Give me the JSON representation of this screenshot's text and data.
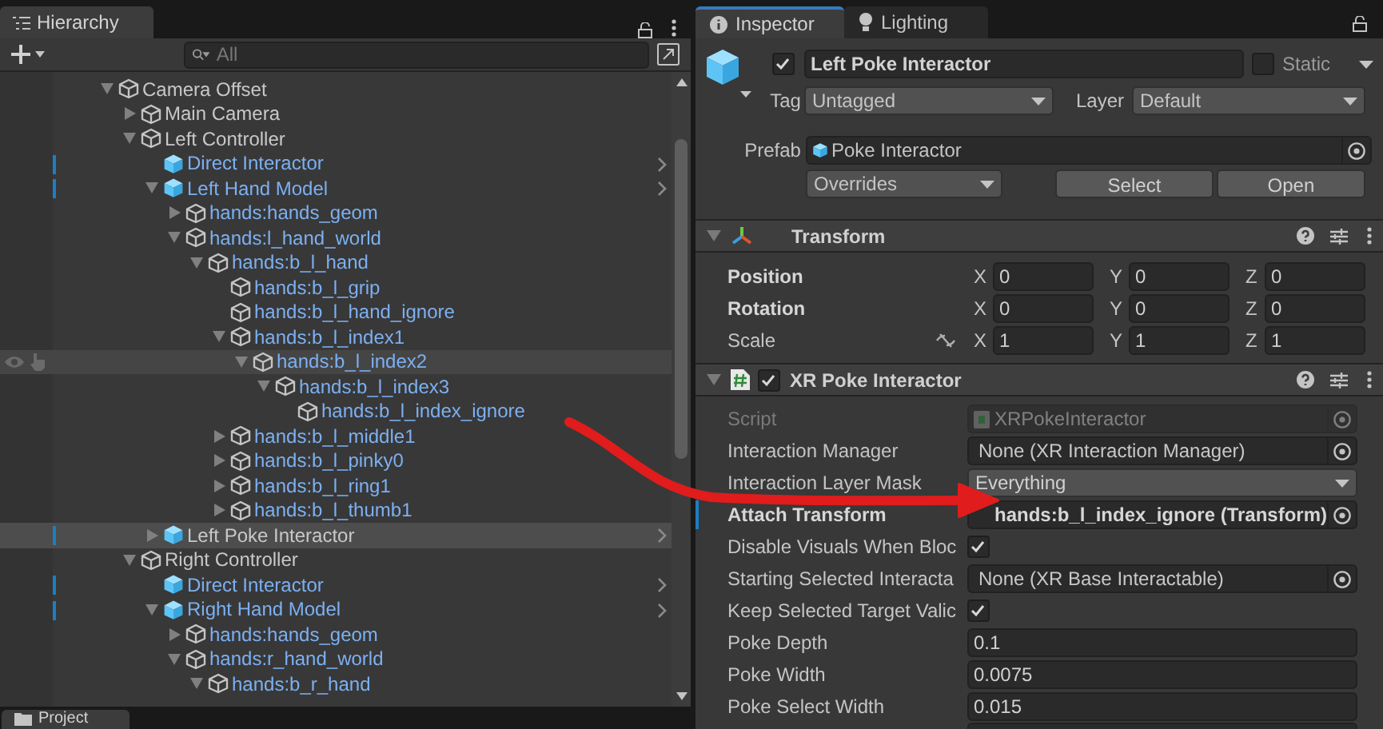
{
  "hierarchy": {
    "tab": {
      "label": "Hierarchy",
      "selected": true
    },
    "search": {
      "placeholder": "All"
    },
    "tree": [
      {
        "name": "Camera Offset",
        "kind": "object",
        "in_prefab": false,
        "selected": false,
        "hovered": false,
        "expanded": true,
        "children": [
          {
            "name": "Main Camera",
            "kind": "object",
            "in_prefab": false,
            "selected": false,
            "hovered": false,
            "expanded": false
          },
          {
            "name": "Left Controller",
            "kind": "object",
            "in_prefab": false,
            "selected": false,
            "hovered": false,
            "expanded": true,
            "children": [
              {
                "name": "Direct Interactor",
                "kind": "prefab",
                "in_prefab": true,
                "selected": false,
                "hovered": false
              },
              {
                "name": "Left Hand Model",
                "kind": "prefab",
                "in_prefab": true,
                "selected": false,
                "hovered": false,
                "expanded": true,
                "children": [
                  {
                    "name": "hands:hands_geom",
                    "kind": "object",
                    "in_prefab": true,
                    "selected": false,
                    "hovered": false,
                    "expanded": false
                  },
                  {
                    "name": "hands:l_hand_world",
                    "kind": "object",
                    "in_prefab": true,
                    "selected": false,
                    "hovered": false,
                    "expanded": true,
                    "children": [
                      {
                        "name": "hands:b_l_hand",
                        "kind": "object",
                        "in_prefab": true,
                        "selected": false,
                        "hovered": false,
                        "expanded": true,
                        "children": [
                          {
                            "name": "hands:b_l_grip",
                            "kind": "object",
                            "in_prefab": true,
                            "selected": false,
                            "hovered": false
                          },
                          {
                            "name": "hands:b_l_hand_ignore",
                            "kind": "object",
                            "in_prefab": true,
                            "selected": false,
                            "hovered": false
                          },
                          {
                            "name": "hands:b_l_index1",
                            "kind": "object",
                            "in_prefab": true,
                            "selected": false,
                            "hovered": false,
                            "expanded": true,
                            "children": [
                              {
                                "name": "hands:b_l_index2",
                                "kind": "object",
                                "in_prefab": true,
                                "selected": false,
                                "hovered": true,
                                "expanded": true,
                                "children": [
                                  {
                                    "name": "hands:b_l_index3",
                                    "kind": "object",
                                    "in_prefab": true,
                                    "selected": false,
                                    "hovered": false,
                                    "expanded": true,
                                    "children": [
                                      {
                                        "name": "hands:b_l_index_ignore",
                                        "kind": "object",
                                        "in_prefab": true,
                                        "selected": false,
                                        "hovered": false
                                      }
                                    ]
                                  }
                                ]
                              }
                            ]
                          },
                          {
                            "name": "hands:b_l_middle1",
                            "kind": "object",
                            "in_prefab": true,
                            "selected": false,
                            "hovered": false,
                            "expanded": false
                          },
                          {
                            "name": "hands:b_l_pinky0",
                            "kind": "object",
                            "in_prefab": true,
                            "selected": false,
                            "hovered": false,
                            "expanded": false
                          },
                          {
                            "name": "hands:b_l_ring1",
                            "kind": "object",
                            "in_prefab": true,
                            "selected": false,
                            "hovered": false,
                            "expanded": false
                          },
                          {
                            "name": "hands:b_l_thumb1",
                            "kind": "object",
                            "in_prefab": true,
                            "selected": false,
                            "hovered": false,
                            "expanded": false
                          }
                        ]
                      }
                    ]
                  }
                ]
              },
              {
                "name": "Left Poke Interactor",
                "kind": "prefab",
                "in_prefab": false,
                "selected": true,
                "hovered": false,
                "expanded": false
              }
            ]
          },
          {
            "name": "Right Controller",
            "kind": "object",
            "in_prefab": false,
            "selected": false,
            "hovered": false,
            "expanded": true,
            "children": [
              {
                "name": "Direct Interactor",
                "kind": "prefab",
                "in_prefab": true,
                "selected": false,
                "hovered": false
              },
              {
                "name": "Right Hand Model",
                "kind": "prefab",
                "in_prefab": true,
                "selected": false,
                "hovered": false,
                "expanded": true,
                "children": [
                  {
                    "name": "hands:hands_geom",
                    "kind": "object",
                    "in_prefab": true,
                    "selected": false,
                    "hovered": false,
                    "expanded": false
                  },
                  {
                    "name": "hands:r_hand_world",
                    "kind": "object",
                    "in_prefab": true,
                    "selected": false,
                    "hovered": false,
                    "expanded": true,
                    "children": [
                      {
                        "name": "hands:b_r_hand",
                        "kind": "object",
                        "in_prefab": true,
                        "selected": false,
                        "hovered": false,
                        "expanded": true
                      }
                    ]
                  }
                ]
              }
            ]
          }
        ]
      }
    ]
  },
  "project_tab": {
    "label": "Project",
    "selected": true
  },
  "inspector": {
    "tabs": [
      {
        "label": "Inspector",
        "selected": true
      },
      {
        "label": "Lighting",
        "selected": false
      }
    ],
    "object": {
      "active": true,
      "name": "Left Poke Interactor",
      "static": false,
      "static_label": "Static",
      "tag_label": "Tag",
      "tag": "Untagged",
      "layer_label": "Layer",
      "layer": "Default"
    },
    "prefab": {
      "label": "Prefab",
      "asset": "Poke Interactor",
      "overrides": "Overrides",
      "buttons": [
        "Select",
        "Open"
      ]
    },
    "transform": {
      "title": "Transform",
      "expanded": true,
      "rows": [
        {
          "label": "Position",
          "overridden": true,
          "fields": [
            {
              "axis": "X",
              "value": "0"
            },
            {
              "axis": "Y",
              "value": "0"
            },
            {
              "axis": "Z",
              "value": "0"
            }
          ]
        },
        {
          "label": "Rotation",
          "overridden": true,
          "fields": [
            {
              "axis": "X",
              "value": "0"
            },
            {
              "axis": "Y",
              "value": "0"
            },
            {
              "axis": "Z",
              "value": "0"
            }
          ]
        },
        {
          "label": "Scale",
          "overridden": false,
          "fields": [
            {
              "axis": "X",
              "value": "1"
            },
            {
              "axis": "Y",
              "value": "1"
            },
            {
              "axis": "Z",
              "value": "1"
            }
          ]
        }
      ]
    },
    "component": {
      "title": "XR Poke Interactor",
      "expanded": true,
      "enabled": true,
      "properties": [
        {
          "label": "Script",
          "kind": "object",
          "value": "XRPokeInteractor",
          "disabled": true,
          "overridden": false
        },
        {
          "label": "Interaction Manager",
          "kind": "object",
          "value": "None (XR Interaction Manager)",
          "disabled": false,
          "overridden": false
        },
        {
          "label": "Interaction Layer Mask",
          "kind": "dropdown",
          "value": "Everything",
          "disabled": false,
          "overridden": false
        },
        {
          "label": "Attach Transform",
          "kind": "object",
          "value": "hands:b_l_index_ignore (Transform)",
          "disabled": false,
          "overridden": true
        },
        {
          "label": "Disable Visuals When Bloc",
          "kind": "checkbox",
          "checked": true,
          "disabled": false,
          "overridden": false
        },
        {
          "label": "Starting Selected Interacta",
          "kind": "object",
          "value": "None (XR Base Interactable)",
          "disabled": false,
          "overridden": false
        },
        {
          "label": "Keep Selected Target Valic",
          "kind": "checkbox",
          "checked": true,
          "disabled": false,
          "overridden": false
        },
        {
          "label": "Poke Depth",
          "kind": "number",
          "value": "0.1",
          "disabled": false,
          "overridden": false
        },
        {
          "label": "Poke Width",
          "kind": "number",
          "value": "0.0075",
          "disabled": false,
          "overridden": false
        },
        {
          "label": "Poke Select Width",
          "kind": "number",
          "value": "0.015",
          "disabled": false,
          "overridden": false
        }
      ]
    }
  }
}
